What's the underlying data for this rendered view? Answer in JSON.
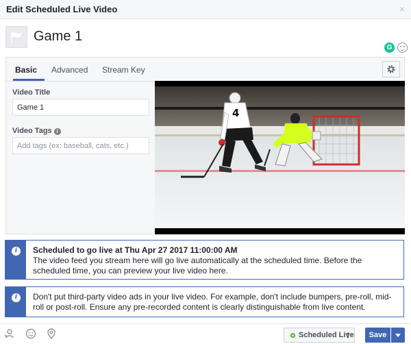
{
  "dialog": {
    "title": "Edit Scheduled Live Video",
    "close_glyph": "×"
  },
  "post": {
    "name": "Game 1",
    "thumb_icon": "flag-icon"
  },
  "tabs": [
    {
      "label": "Basic",
      "active": true
    },
    {
      "label": "Advanced",
      "active": false
    },
    {
      "label": "Stream Key",
      "active": false
    }
  ],
  "form": {
    "title_label": "Video Title",
    "title_value": "Game 1",
    "tags_label": "Video Tags",
    "tags_placeholder": "Add tags (ex: baseball, cats, etc.)"
  },
  "notices": [
    {
      "heading": "Scheduled to go live at Thu Apr 27 2017 11:00:00 AM",
      "text": "The video feed you stream here will go live automatically at the scheduled time. Before the scheduled time, you can preview your live video here."
    },
    {
      "heading": "",
      "text": "Don't put third-party video ads in your live video. For example, don't include bumpers, pre-roll, mid-roll or post-roll. Ensure any pre-recorded content is clearly distinguishable from live content."
    }
  ],
  "footer": {
    "schedule_label": "Scheduled Live",
    "save_label": "Save"
  },
  "colors": {
    "brand_blue": "#4267b2",
    "grammarly_green": "#15c39a",
    "status_green": "#42b72a"
  }
}
